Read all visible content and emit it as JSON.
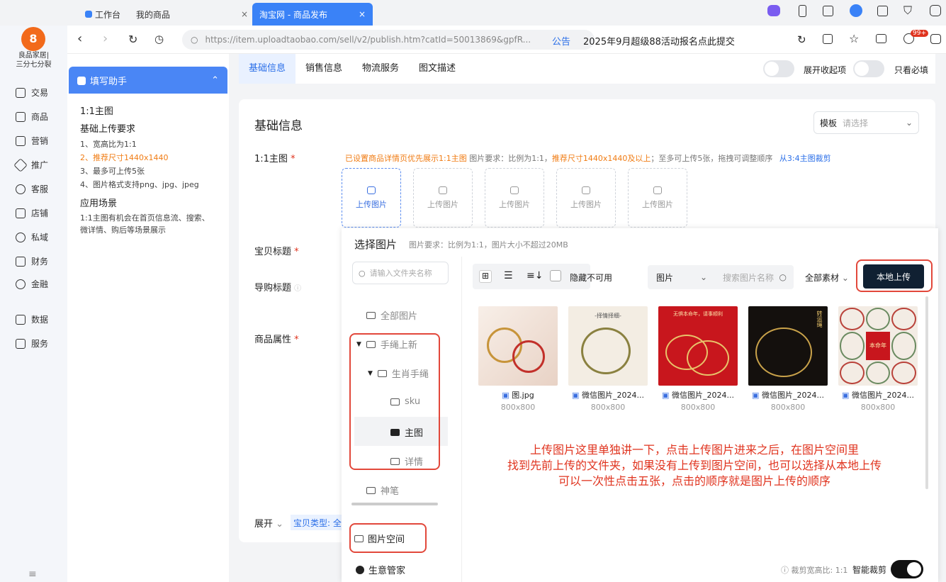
{
  "browser": {
    "tabs": [
      {
        "label": "工作台"
      },
      {
        "label": "我的商品"
      },
      {
        "label": "淘宝网 - 商品发布"
      }
    ],
    "url": "https://item.uploadtaobao.com/sell/v2/publish.htm?catId=50013869&gpfR...",
    "notice_label": "公告",
    "notice_text": "2025年9月超级88活动报名点此提交",
    "badge_count": "99+"
  },
  "shop": {
    "name_line1": "良品家居|",
    "name_line2": "三分七分裂"
  },
  "rail": {
    "items": [
      {
        "label": "交易",
        "icon": "trade-icon"
      },
      {
        "label": "商品",
        "icon": "goods-icon"
      },
      {
        "label": "营销",
        "icon": "marketing-icon"
      },
      {
        "label": "推广",
        "icon": "promote-icon"
      },
      {
        "label": "客服",
        "icon": "service-icon"
      },
      {
        "label": "店铺",
        "icon": "shop-icon"
      },
      {
        "label": "私域",
        "icon": "private-icon"
      },
      {
        "label": "财务",
        "icon": "finance-icon"
      },
      {
        "label": "金融",
        "icon": "bank-icon"
      },
      {
        "label": "数据",
        "icon": "data-icon"
      },
      {
        "label": "服务",
        "icon": "services-icon"
      }
    ]
  },
  "helper": {
    "title": "填写助手",
    "section_title": "1:1主图",
    "req_title": "基础上传要求",
    "req1": "1、宽高比为1:1",
    "req2": "2、推荐尺寸1440x1440",
    "req3": "3、最多可上传5张",
    "req4": "4、图片格式支持png、jpg、jpeg",
    "scene_title": "应用场景",
    "scene_text": "1:1主图有机会在首页信息流、搜索、微详情、购后等场景展示"
  },
  "nav": {
    "tabs": [
      "基础信息",
      "销售信息",
      "物流服务",
      "图文描述"
    ],
    "toggle1_label": "展开收起项",
    "toggle2_label": "只看必填"
  },
  "form": {
    "section_title": "基础信息",
    "template_label": "模板",
    "template_placeholder": "请选择",
    "main_image_label": "1:1主图",
    "main_image_hint_orange1": "已设置商品详情页优先展示1:1主图",
    "main_image_hint_grey1": "图片要求：比例为1:1，",
    "main_image_hint_orange2": "推荐尺寸1440x1440及以上",
    "main_image_hint_grey2": "；至多可上传5张，拖拽可调整顺序",
    "main_image_hint_link": "从3:4主图裁剪",
    "upload_label": "上传图片",
    "title_label": "宝贝标题",
    "guide_title_label": "导购标题",
    "attr_label": "商品属性",
    "expand_label": "展开",
    "type_label": "宝贝类型: 全"
  },
  "picker": {
    "title": "选择图片",
    "hint": "图片要求：比例为1:1，图片大小不超过20MB",
    "folder_search_placeholder": "请输入文件夹名称",
    "hide_unavailable": "隐藏不可用",
    "filter_type": "图片",
    "search_placeholder": "搜索图片名称",
    "all_materials": "全部素材",
    "local_upload": "本地上传",
    "folders": [
      "全部图片",
      "手绳上新",
      "生肖手绳",
      "sku",
      "主图",
      "详情",
      "神笔"
    ],
    "bottom_items": [
      "图片空间",
      "生意管家"
    ],
    "crop_ratio": "裁剪宽高比: 1:1",
    "smart_crop": "智能裁剪",
    "images": [
      {
        "name": "图.jpg",
        "size": "800x800"
      },
      {
        "name": "微信图片_2024...",
        "size": "800x800"
      },
      {
        "name": "微信图片_2024...",
        "size": "800x800"
      },
      {
        "name": "微信图片_2024...",
        "size": "800x800"
      },
      {
        "name": "微信图片_2024...",
        "size": "800x800"
      }
    ],
    "thumb2_text": "-择情择细-",
    "thumb3_text": "无惧本命年，请事顺利",
    "thumb4_text": "转运绳",
    "thumb5_text": "本命年"
  },
  "annotation": {
    "line1": "上传图片这里单独讲一下，点击上传图片进来之后，在图片空间里",
    "line2": "找到先前上传的文件夹，如果没有上传到图片空间，也可以选择从本地上传",
    "line3": "可以一次性点击五张，点击的顺序就是图片上传的顺序"
  },
  "colors": {
    "accent": "#3a82f7",
    "annotation_red": "#e0341f",
    "hint_orange": "#f07c14"
  }
}
